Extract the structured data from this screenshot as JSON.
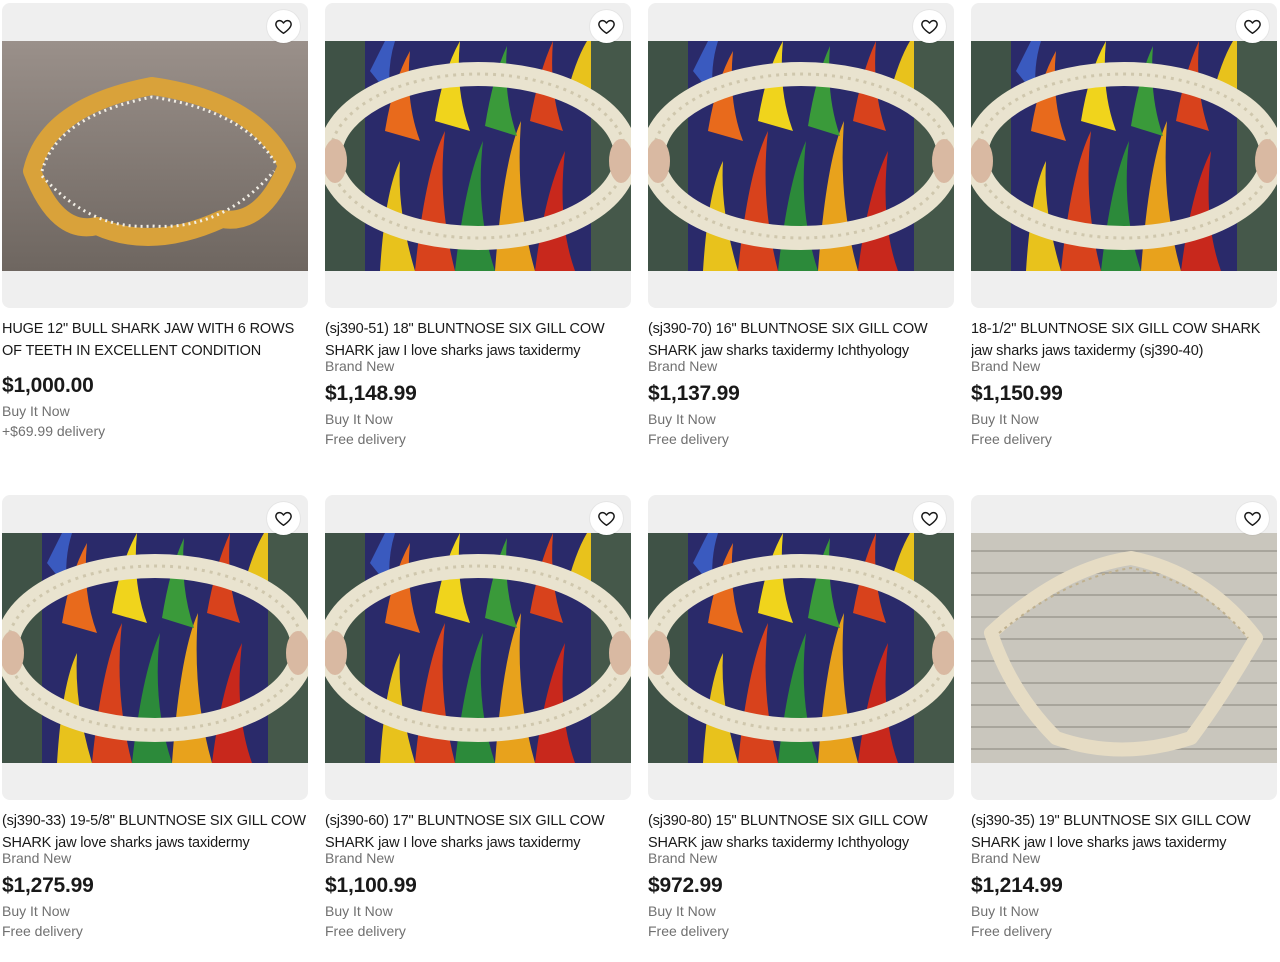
{
  "listings": [
    {
      "title": "HUGE 12\" BULL SHARK JAW WITH 6 ROWS OF TEETH IN EXCELLENT CONDITION",
      "subtitle": "",
      "price": "$1,000.00",
      "format": "Buy It Now",
      "shipping": "+$69.99 delivery",
      "image": "bull-shark-jaw-photo"
    },
    {
      "title": "(sj390-51) 18\" BLUNTNOSE SIX GILL COW SHARK jaw I love sharks jaws taxidermy",
      "subtitle": "Brand New",
      "price": "$1,148.99",
      "format": "Buy It Now",
      "shipping": "Free delivery",
      "image": "shark-jaw-held-photo"
    },
    {
      "title": "(sj390-70) 16\" BLUNTNOSE SIX GILL COW SHARK jaw sharks taxidermy Ichthyology",
      "subtitle": "Brand New",
      "price": "$1,137.99",
      "format": "Buy It Now",
      "shipping": "Free delivery",
      "image": "shark-jaw-held-photo"
    },
    {
      "title": "18-1/2\" BLUNTNOSE SIX GILL COW SHARK jaw sharks jaws taxidermy (sj390-40)",
      "subtitle": "Brand New",
      "price": "$1,150.99",
      "format": "Buy It Now",
      "shipping": "Free delivery",
      "image": "shark-jaw-held-photo"
    },
    {
      "title": "(sj390-33) 19-5/8\" BLUNTNOSE SIX GILL COW SHARK jaw love sharks jaws taxidermy",
      "subtitle": "Brand New",
      "price": "$1,275.99",
      "format": "Buy It Now",
      "shipping": "Free delivery",
      "image": "shark-jaw-held-photo"
    },
    {
      "title": "(sj390-60) 17\" BLUNTNOSE SIX GILL COW SHARK jaw I love sharks jaws taxidermy",
      "subtitle": "Brand New",
      "price": "$1,100.99",
      "format": "Buy It Now",
      "shipping": "Free delivery",
      "image": "shark-jaw-held-photo"
    },
    {
      "title": "(sj390-80) 15\" BLUNTNOSE SIX GILL COW SHARK jaw sharks taxidermy Ichthyology",
      "subtitle": "Brand New",
      "price": "$972.99",
      "format": "Buy It Now",
      "shipping": "Free delivery",
      "image": "shark-jaw-held-photo"
    },
    {
      "title": "(sj390-35) 19\" BLUNTNOSE SIX GILL COW SHARK jaw I love sharks jaws taxidermy",
      "subtitle": "Brand New",
      "price": "$1,214.99",
      "format": "Buy It Now",
      "shipping": "Free delivery",
      "image": "shark-jaw-on-siding-photo"
    }
  ],
  "icons": {
    "watch": "heart-icon"
  },
  "colors": {
    "text": "#191919",
    "muted": "#707070",
    "card_bg": "#efefef"
  }
}
